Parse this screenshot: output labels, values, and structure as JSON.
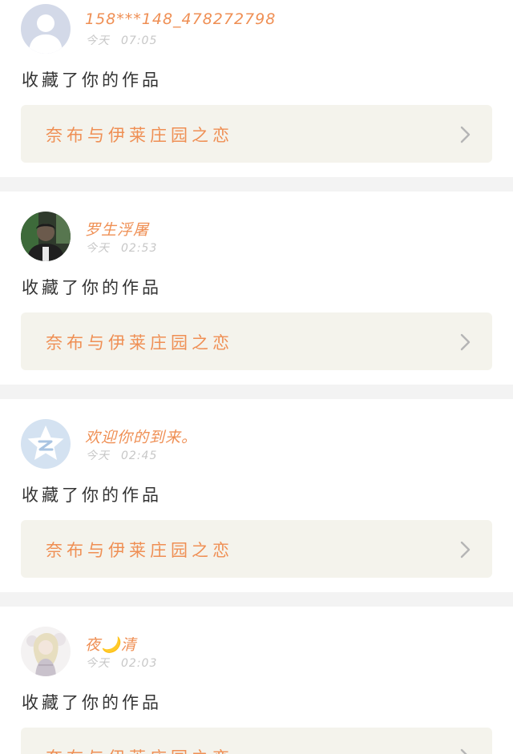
{
  "feed": {
    "items": [
      {
        "username": "158***148_478272798",
        "day": "今天",
        "time": "07:05",
        "action": "收藏了你的作品",
        "work_title": "奈布与伊莱庄园之恋",
        "avatar": "default-person-avatar"
      },
      {
        "username": "罗生浮屠",
        "day": "今天",
        "time": "02:53",
        "action": "收藏了你的作品",
        "work_title": "奈布与伊莱庄园之恋",
        "avatar": "photo-avatar"
      },
      {
        "username": "欢迎你的到来。",
        "day": "今天",
        "time": "02:45",
        "action": "收藏了你的作品",
        "work_title": "奈布与伊莱庄园之恋",
        "avatar": "qzone-star-avatar"
      },
      {
        "username": "夜🌙清",
        "day": "今天",
        "time": "02:03",
        "action": "收藏了你的作品",
        "work_title": "奈布与伊莱庄园之恋",
        "avatar": "anime-illustration-avatar"
      }
    ]
  },
  "colors": {
    "accent": "#ef8f54",
    "card_bg": "#f4f3ec",
    "separator": "#f3f3f3",
    "time": "#c7c7c7",
    "text": "#333333"
  }
}
